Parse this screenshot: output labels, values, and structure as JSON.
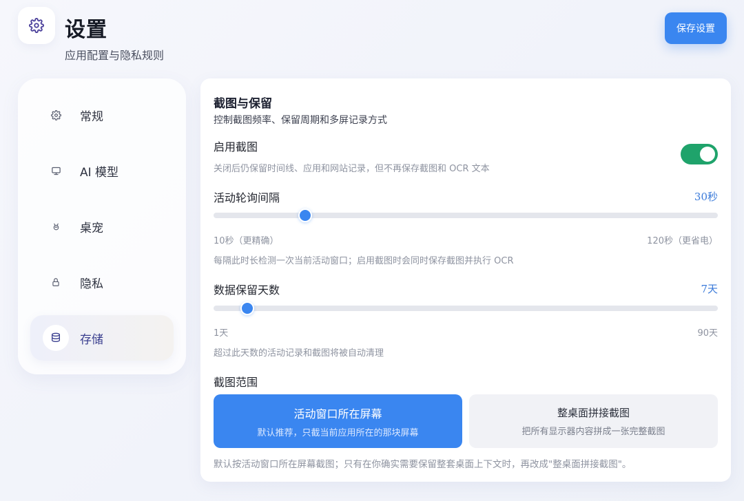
{
  "header": {
    "icon": "gear-icon",
    "title": "设置",
    "subtitle": "应用配置与隐私规则",
    "save_label": "保存设置"
  },
  "sidebar": {
    "items": [
      {
        "label": "常规",
        "icon": "gear-icon",
        "active": false
      },
      {
        "label": "AI 模型",
        "icon": "monitor-icon",
        "active": false
      },
      {
        "label": "桌宠",
        "icon": "pet-icon",
        "active": false
      },
      {
        "label": "隐私",
        "icon": "lock-icon",
        "active": false
      },
      {
        "label": "存储",
        "icon": "database-icon",
        "active": true
      }
    ]
  },
  "main": {
    "section_title": "截图与保留",
    "section_desc": "控制截图频率、保留周期和多屏记录方式",
    "enable_screenshot": {
      "label": "启用截图",
      "help": "关闭后仍保留时间线、应用和网站记录，但不再保存截图和 OCR 文本",
      "enabled": true
    },
    "poll_interval": {
      "label": "活动轮询间隔",
      "value_text": "30秒",
      "value": 30,
      "min": 10,
      "max": 120,
      "min_label": "10秒（更精确）",
      "max_label": "120秒（更省电）",
      "help": "每隔此时长检测一次当前活动窗口；启用截图时会同时保存截图并执行 OCR"
    },
    "retention_days": {
      "label": "数据保留天数",
      "value_text": "7天",
      "value": 7,
      "min": 1,
      "max": 90,
      "min_label": "1天",
      "max_label": "90天",
      "help": "超过此天数的活动记录和截图将被自动清理"
    },
    "capture_scope": {
      "label": "截图范围",
      "options": [
        {
          "title": "活动窗口所在屏幕",
          "desc": "默认推荐，只截当前应用所在的那块屏幕",
          "selected": true
        },
        {
          "title": "整桌面拼接截图",
          "desc": "把所有显示器内容拼成一张完整截图",
          "selected": false
        }
      ],
      "note": "默认按活动窗口所在屏幕截图；只有在你确实需要保留整套桌面上下文时，再改成\"整桌面拼接截图\"。"
    }
  },
  "colors": {
    "accent": "#3a86f0",
    "toggle_on": "#1fa36b",
    "active_nav_text": "#3a3f8f"
  }
}
